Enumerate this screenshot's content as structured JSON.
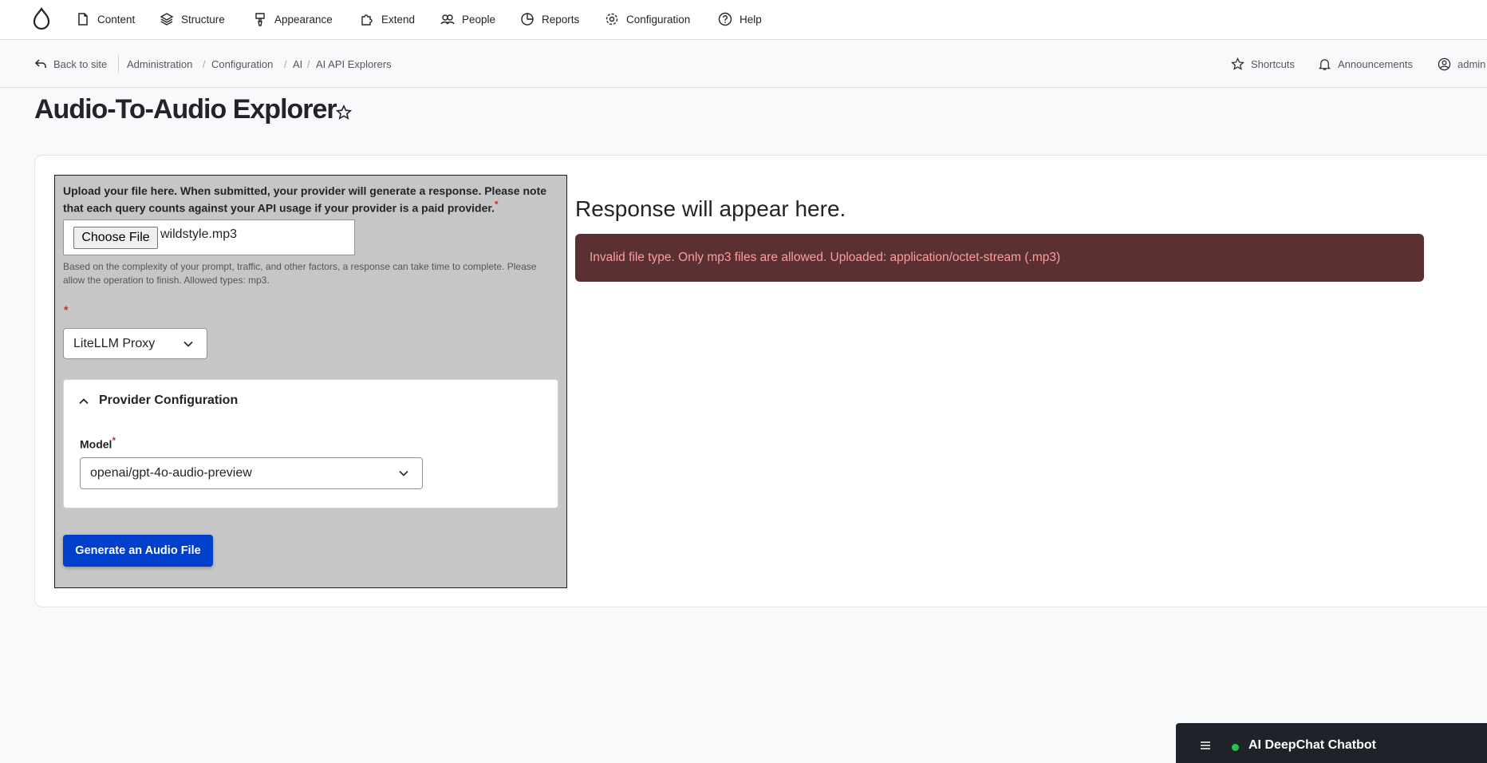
{
  "toolbar": {
    "logo": "drupal-drop-icon",
    "items": [
      {
        "label": "Content",
        "icon": "file-icon"
      },
      {
        "label": "Structure",
        "icon": "layers-icon"
      },
      {
        "label": "Appearance",
        "icon": "brush-icon"
      },
      {
        "label": "Extend",
        "icon": "puzzle-icon"
      },
      {
        "label": "People",
        "icon": "people-icon"
      },
      {
        "label": "Reports",
        "icon": "chart-icon"
      },
      {
        "label": "Configuration",
        "icon": "gear-icon"
      },
      {
        "label": "Help",
        "icon": "help-icon"
      }
    ]
  },
  "breadcrumb": {
    "back": "Back to site",
    "items": [
      "Administration",
      "Configuration",
      "AI",
      "AI API Explorers"
    ]
  },
  "utility": {
    "shortcuts": "Shortcuts",
    "announcements": "Announcements",
    "user": "admin"
  },
  "page": {
    "title": "Audio-To-Audio Explorer"
  },
  "form": {
    "upload_label": "Upload your file here. When submitted, your provider will generate a response. Please note that each query counts against your API usage if your provider is a paid provider.",
    "required_mark": "*",
    "choose_file": "Choose File",
    "file_name": "wildstyle.mp3",
    "description": "Based on the complexity of your prompt, traffic, and other factors, a response can take time to complete. Please allow the operation to finish. Allowed types: mp3.",
    "provider_value": "LiteLLM Proxy",
    "provider_config_title": "Provider Configuration",
    "model_label": "Model",
    "model_value": "openai/gpt-4o-audio-preview",
    "generate_button": "Generate an Audio File"
  },
  "response": {
    "title": "Response will appear here.",
    "error": "Invalid file type. Only mp3 files are allowed. Uploaded: application/octet-stream (.mp3)"
  },
  "chatbot": {
    "title": "AI DeepChat Chatbot",
    "status_color": "#27c24c"
  },
  "colors": {
    "primary_button": "#003ecc",
    "alert_bg": "#5a3033",
    "alert_text": "#ff9d9d"
  }
}
